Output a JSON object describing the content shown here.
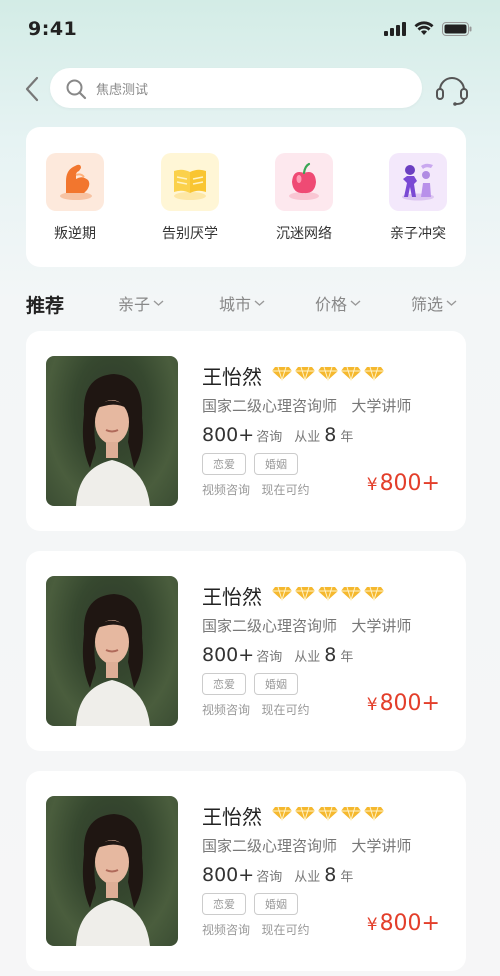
{
  "status_bar": {
    "time": "9:41"
  },
  "search": {
    "text": "焦虑测试"
  },
  "categories": [
    {
      "label": "叛逆期",
      "icon": "flexed-arm-icon"
    },
    {
      "label": "告别厌学",
      "icon": "open-book-icon"
    },
    {
      "label": "沉迷网络",
      "icon": "apple-icon"
    },
    {
      "label": "亲子冲突",
      "icon": "parent-child-icon"
    }
  ],
  "filter": {
    "title": "推荐",
    "items": [
      "亲子",
      "城市",
      "价格",
      "筛选"
    ]
  },
  "doctors": [
    {
      "name": "王怡然",
      "stars": 5,
      "qualification": "国家二级心理咨询师",
      "position": "大学讲师",
      "consult_count": "800+",
      "consult_label": "咨询",
      "practice_prefix": "从业",
      "practice_years": "8",
      "practice_suffix": "年",
      "tags": [
        "恋爱",
        "婚姻"
      ],
      "service": "视频咨询",
      "availability": "现在可约",
      "currency": "¥",
      "price": "800+"
    },
    {
      "name": "王怡然",
      "stars": 5,
      "qualification": "国家二级心理咨询师",
      "position": "大学讲师",
      "consult_count": "800+",
      "consult_label": "咨询",
      "practice_prefix": "从业",
      "practice_years": "8",
      "practice_suffix": "年",
      "tags": [
        "恋爱",
        "婚姻"
      ],
      "service": "视频咨询",
      "availability": "现在可约",
      "currency": "¥",
      "price": "800+"
    },
    {
      "name": "王怡然",
      "stars": 5,
      "qualification": "国家二级心理咨询师",
      "position": "大学讲师",
      "consult_count": "800+",
      "consult_label": "咨询",
      "practice_prefix": "从业",
      "practice_years": "8",
      "practice_suffix": "年",
      "tags": [
        "恋爱",
        "婚姻"
      ],
      "service": "视频咨询",
      "availability": "现在可约",
      "currency": "¥",
      "price": "800+"
    }
  ],
  "colors": {
    "accent_price": "#e33e2a",
    "rating_gold": "#f5b82e"
  }
}
